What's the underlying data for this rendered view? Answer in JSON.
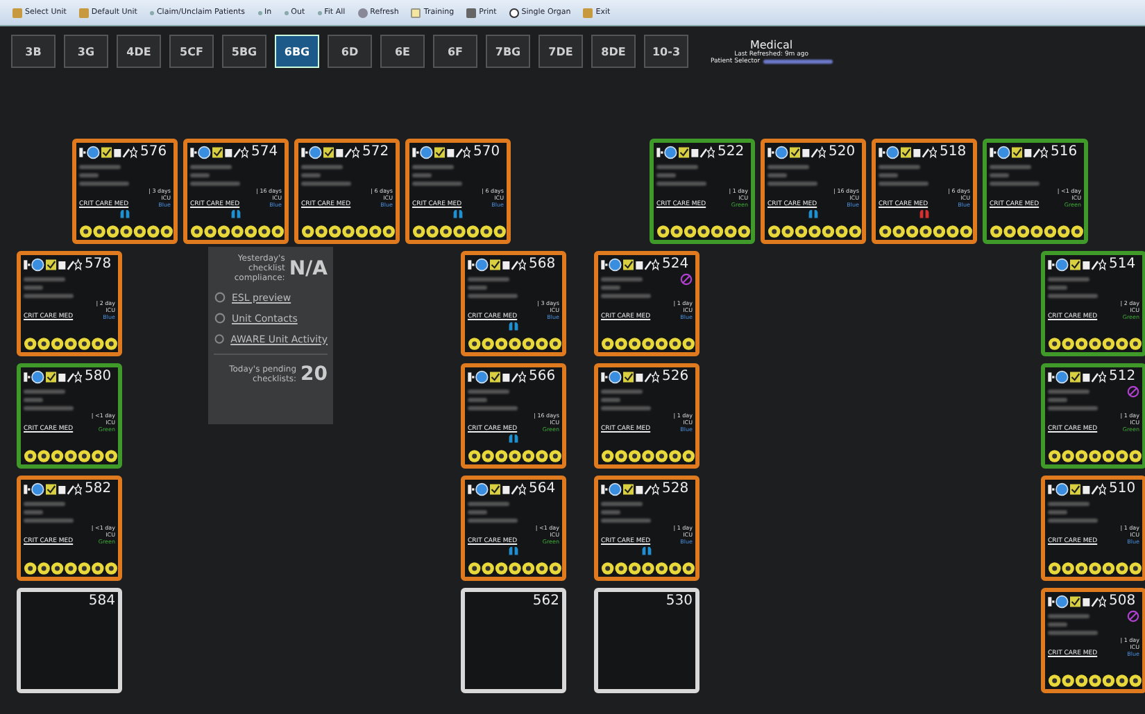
{
  "toolbar": [
    {
      "label": "Select Unit"
    },
    {
      "label": "Default Unit"
    },
    {
      "label": "Claim/Unclaim Patients"
    },
    {
      "label": "In"
    },
    {
      "label": "Out"
    },
    {
      "label": "Fit All"
    },
    {
      "label": "Refresh"
    },
    {
      "label": "Training"
    },
    {
      "label": "Print"
    },
    {
      "label": "Single Organ"
    },
    {
      "label": "Exit"
    }
  ],
  "units": [
    {
      "label": "3B",
      "selected": false
    },
    {
      "label": "3G",
      "selected": false
    },
    {
      "label": "4DE",
      "selected": false
    },
    {
      "label": "5CF",
      "selected": false
    },
    {
      "label": "5BG",
      "selected": false
    },
    {
      "label": "6BG",
      "selected": true
    },
    {
      "label": "6D",
      "selected": false
    },
    {
      "label": "6E",
      "selected": false
    },
    {
      "label": "6F",
      "selected": false
    },
    {
      "label": "7BG",
      "selected": false
    },
    {
      "label": "7DE",
      "selected": false
    },
    {
      "label": "8DE",
      "selected": false
    },
    {
      "label": "10-3",
      "selected": false
    }
  ],
  "header": {
    "title": "Medical",
    "refreshed": "Last Refreshed: 9m ago",
    "selector_label": "Patient Selector"
  },
  "panel": {
    "compliance_label": "Yesterday's checklist compliance:",
    "compliance_value": "N/A",
    "links": [
      "ESL preview",
      "Unit Contacts",
      "AWARE Unit Activity"
    ],
    "pending_label": "Today's pending checklists:",
    "pending_value": "20"
  },
  "rooms": [
    {
      "number": "576",
      "occupied": true,
      "color": "#e07a1f",
      "los": "| 3 days",
      "unit": "ICU",
      "status": "Blue",
      "service": "CRIT CARE MED",
      "device": {
        "color": "#1f8fd0"
      },
      "blocked": false
    },
    {
      "number": "574",
      "occupied": true,
      "color": "#e07a1f",
      "los": "| 16 days",
      "unit": "ICU",
      "status": "Blue",
      "service": "CRIT CARE MED",
      "device": {
        "color": "#1f8fd0"
      },
      "blocked": false
    },
    {
      "number": "572",
      "occupied": true,
      "color": "#e07a1f",
      "los": "| 6 days",
      "unit": "ICU",
      "status": "Blue",
      "service": "CRIT CARE MED",
      "blocked": false
    },
    {
      "number": "570",
      "occupied": true,
      "color": "#e07a1f",
      "los": "| 6 days",
      "unit": "ICU",
      "status": "Blue",
      "service": "CRIT CARE MED",
      "device": {
        "color": "#1f8fd0"
      },
      "blocked": false
    },
    {
      "number": "522",
      "occupied": true,
      "color": "#3f9a2a",
      "los": "| 1 day",
      "unit": "ICU",
      "status": "Green",
      "service": "CRIT CARE MED",
      "blocked": false
    },
    {
      "number": "520",
      "occupied": true,
      "color": "#e07a1f",
      "los": "| 16 days",
      "unit": "ICU",
      "status": "Blue",
      "service": "CRIT CARE MED",
      "device": {
        "color": "#1f8fd0"
      },
      "blocked": false
    },
    {
      "number": "518",
      "occupied": true,
      "color": "#e07a1f",
      "los": "| 6 days",
      "unit": "ICU",
      "status": "Blue",
      "service": "CRIT CARE MED",
      "device": {
        "color": "#d43030"
      },
      "blocked": false
    },
    {
      "number": "516",
      "occupied": true,
      "color": "#3f9a2a",
      "los": "| <1 day",
      "unit": "ICU",
      "status": "Green",
      "service": "CRIT CARE MED",
      "blocked": false
    },
    {
      "number": "578",
      "occupied": true,
      "color": "#e07a1f",
      "los": "| 2 day",
      "unit": "ICU",
      "status": "Blue",
      "service": "CRIT CARE MED",
      "blocked": false
    },
    {
      "number": "568",
      "occupied": true,
      "color": "#e07a1f",
      "los": "| 3 days",
      "unit": "ICU",
      "status": "Blue",
      "service": "CRIT CARE MED",
      "device": {
        "color": "#1f8fd0"
      },
      "blocked": false
    },
    {
      "number": "524",
      "occupied": true,
      "color": "#e07a1f",
      "los": "| 1 day",
      "unit": "ICU",
      "status": "Blue",
      "service": "CRIT CARE MED",
      "blocked": true
    },
    {
      "number": "514",
      "occupied": true,
      "color": "#3f9a2a",
      "los": "| 2 day",
      "unit": "ICU",
      "status": "Green",
      "service": "CRIT CARE MED",
      "blocked": false
    },
    {
      "number": "580",
      "occupied": true,
      "color": "#3f9a2a",
      "los": "| <1 day",
      "unit": "ICU",
      "status": "Green",
      "service": "CRIT CARE MED",
      "blocked": false
    },
    {
      "number": "566",
      "occupied": true,
      "color": "#e07a1f",
      "los": "| 16 days",
      "unit": "ICU",
      "status": "Green",
      "service": "CRIT CARE MED",
      "device": {
        "color": "#1f8fd0"
      },
      "blocked": false
    },
    {
      "number": "526",
      "occupied": true,
      "color": "#e07a1f",
      "los": "| 1 day",
      "unit": "ICU",
      "status": "Blue",
      "service": "CRIT CARE MED",
      "blocked": false
    },
    {
      "number": "512",
      "occupied": true,
      "color": "#3f9a2a",
      "los": "| 1 day",
      "unit": "ICU",
      "status": "Green",
      "service": "CRIT CARE MED",
      "blocked": true
    },
    {
      "number": "582",
      "occupied": true,
      "color": "#e07a1f",
      "los": "| <1 day",
      "unit": "ICU",
      "status": "Green",
      "service": "CRIT CARE MED",
      "blocked": false
    },
    {
      "number": "564",
      "occupied": true,
      "color": "#e07a1f",
      "los": "| <1 day",
      "unit": "ICU",
      "status": "Green",
      "service": "CRIT CARE MED",
      "device": {
        "color": "#1f8fd0"
      },
      "blocked": false
    },
    {
      "number": "528",
      "occupied": true,
      "color": "#e07a1f",
      "los": "| 1 day",
      "unit": "ICU",
      "status": "Blue",
      "service": "CRIT CARE MED",
      "device": {
        "color": "#1f8fd0"
      },
      "blocked": false
    },
    {
      "number": "510",
      "occupied": true,
      "color": "#e07a1f",
      "los": "| 1 day",
      "unit": "ICU",
      "status": "Blue",
      "service": "CRIT CARE MED",
      "blocked": false
    },
    {
      "number": "584",
      "occupied": false,
      "color": "#d8d8d8",
      "blocked": false
    },
    {
      "number": "562",
      "occupied": false,
      "color": "#d8d8d8",
      "blocked": false
    },
    {
      "number": "530",
      "occupied": false,
      "color": "#d8d8d8",
      "blocked": false
    },
    {
      "number": "508",
      "occupied": true,
      "color": "#e07a1f",
      "los": "| 1 day",
      "unit": "ICU",
      "status": "Blue",
      "service": "CRIT CARE MED",
      "blocked": true
    }
  ]
}
